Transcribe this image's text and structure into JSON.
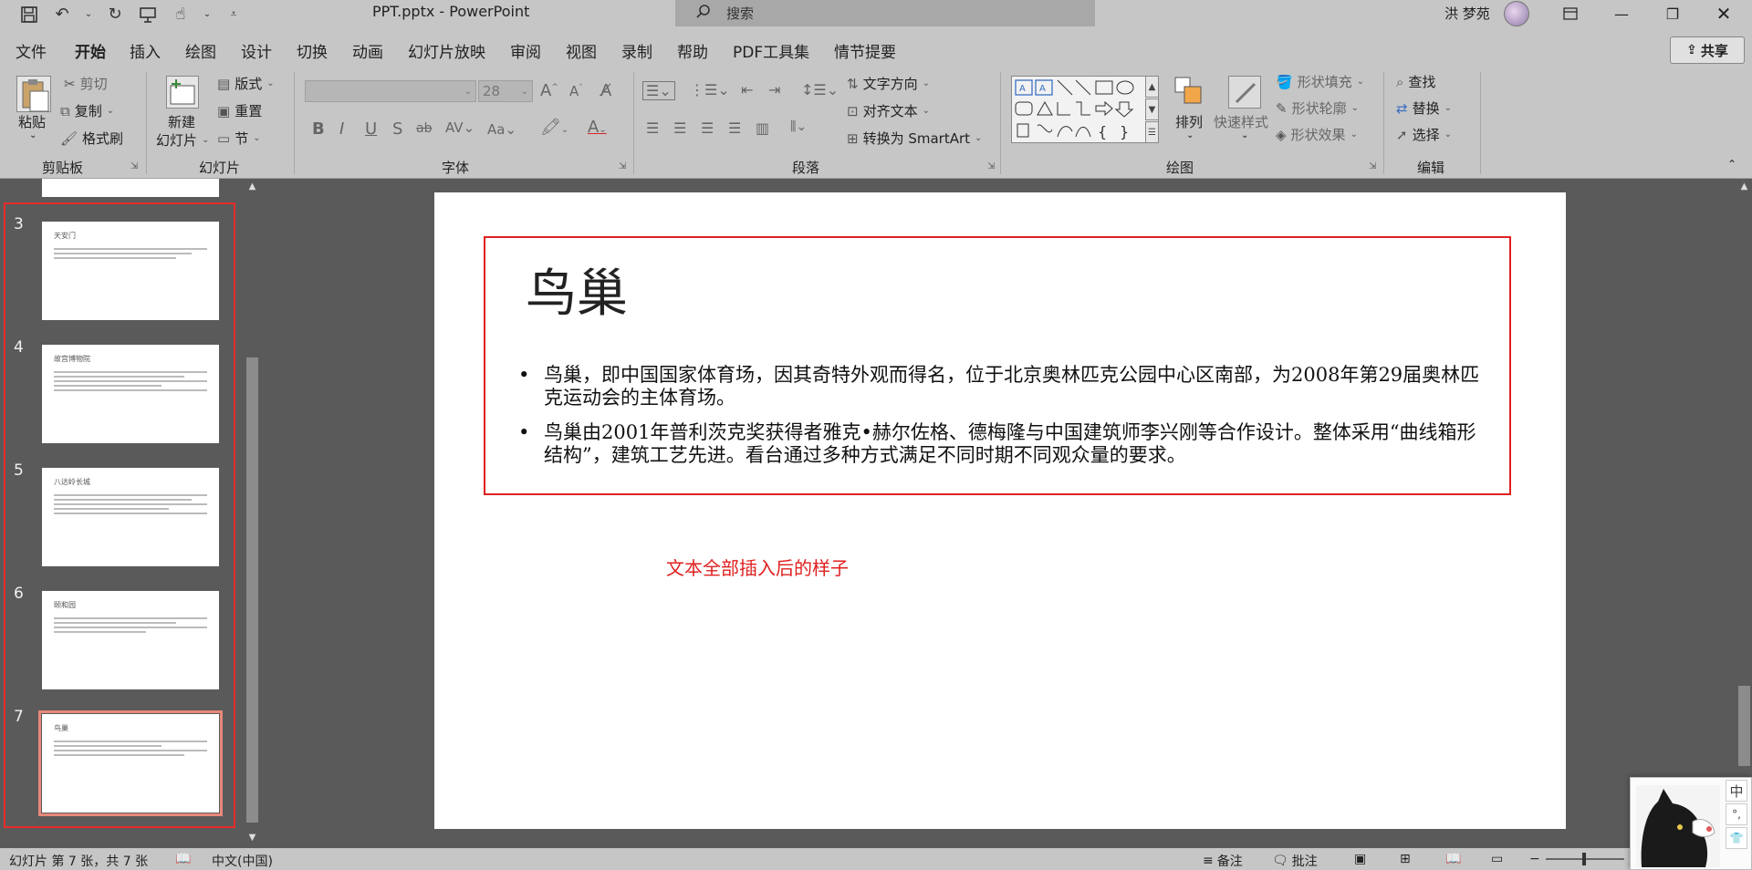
{
  "titlebar": {
    "doc_title": "PPT.pptx  -  PowerPoint",
    "search_placeholder": "搜索",
    "user_name": "洪 梦苑"
  },
  "tabs": [
    "文件",
    "开始",
    "插入",
    "绘图",
    "设计",
    "切换",
    "动画",
    "幻灯片放映",
    "审阅",
    "视图",
    "录制",
    "帮助",
    "PDF工具集",
    "情节提要"
  ],
  "active_tab": "开始",
  "share_label": "共享",
  "ribbon": {
    "clipboard": {
      "paste": "粘贴",
      "cut": "剪切",
      "copy": "复制",
      "format_painter": "格式刷",
      "label": "剪贴板"
    },
    "slides": {
      "new_slide_1": "新建",
      "new_slide_2": "幻灯片",
      "layout": "版式",
      "reset": "重置",
      "section": "节",
      "label": "幻灯片"
    },
    "font": {
      "size": "28",
      "label": "字体"
    },
    "paragraph": {
      "text_direction": "文字方向",
      "align_text": "对齐文本",
      "smartart": "转换为 SmartArt",
      "label": "段落"
    },
    "drawing": {
      "arrange": "排列",
      "quick_styles": "快速样式",
      "shape_fill": "形状填充",
      "shape_outline": "形状轮廓",
      "shape_effects": "形状效果",
      "label": "绘图"
    },
    "editing": {
      "find": "查找",
      "replace": "替换",
      "select": "选择",
      "label": "编辑"
    }
  },
  "thumbnails": [
    {
      "num": "3",
      "title": "天安门"
    },
    {
      "num": "4",
      "title": "故宫博物院"
    },
    {
      "num": "5",
      "title": "八达岭长城"
    },
    {
      "num": "6",
      "title": "颐和园"
    },
    {
      "num": "7",
      "title": "鸟巢"
    }
  ],
  "slide": {
    "title": "鸟巢",
    "bullets": [
      "鸟巢，即中国国家体育场，因其奇特外观而得名，位于北京奥林匹克公园中心区南部，为2008年第29届奥林匹克运动会的主体育场。",
      "鸟巢由2001年普利茨克奖获得者雅克•赫尔佐格、德梅隆与中国建筑师李兴刚等合作设计。整体采用“曲线箱形结构”，建筑工艺先进。看台通过多种方式满足不同时期不同观众量的要求。"
    ],
    "caption": "文本全部插入后的样子"
  },
  "status": {
    "slide_info": "幻灯片 第 7 张，共 7 张",
    "language": "中文(中国)",
    "notes": "备注",
    "comments": "批注"
  },
  "ime": {
    "mode": "中",
    "punct": "°,"
  },
  "colors": {
    "accent_red": "#e02020",
    "ribbon_bg": "#c6c6c6",
    "workspace_bg": "#5a5a5a"
  }
}
